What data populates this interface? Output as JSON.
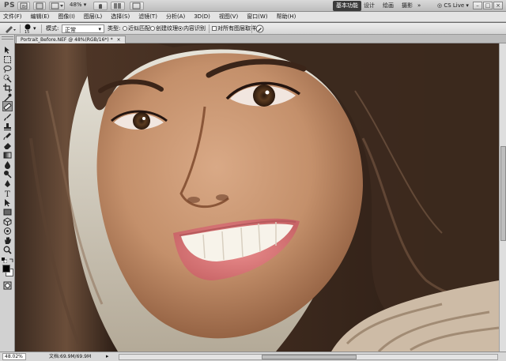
{
  "appbar": {
    "logo": "PS",
    "zoom": "48%",
    "workspaces": [
      "基本功能",
      "设计",
      "绘画",
      "摄影"
    ],
    "active_workspace": "基本功能",
    "cs_live": "CS Live"
  },
  "menubar": [
    "文件(F)",
    "编辑(E)",
    "图像(I)",
    "图层(L)",
    "选择(S)",
    "滤镜(T)",
    "分析(A)",
    "3D(D)",
    "视图(V)",
    "窗口(W)",
    "帮助(H)"
  ],
  "options": {
    "brush_size": "15",
    "mode_label": "模式:",
    "mode_value": "正常",
    "type_label": "类型:",
    "type_options": [
      "近似匹配",
      "创建纹理",
      "内容识别"
    ],
    "type_selected": "内容识别",
    "sample_all_layers": "对所有图层取样"
  },
  "document": {
    "tab_title": "Portrait_Before.NEF @ 48%(RGB/16*) *"
  },
  "status": {
    "zoom": "48.02%",
    "doc_info": "文档:69.9M/69.9M"
  },
  "colors": {
    "foreground": "#000000",
    "background": "#ffffff",
    "active_workspace_bg": "#3b3b3b"
  }
}
